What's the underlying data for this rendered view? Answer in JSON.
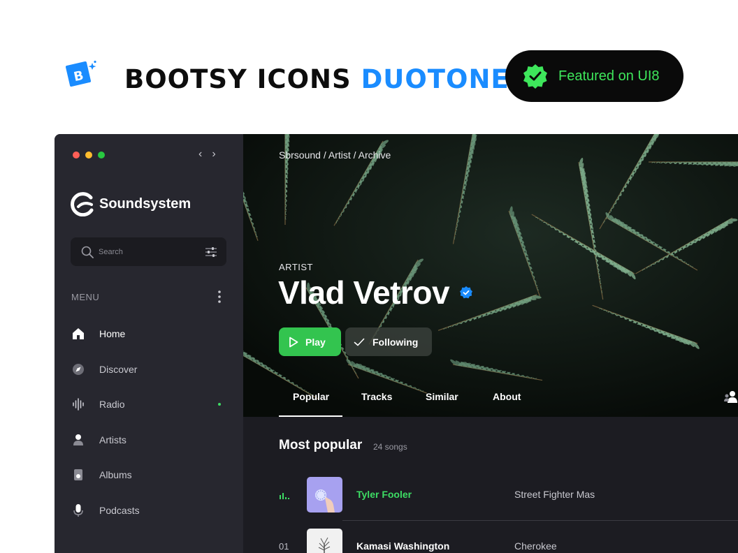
{
  "header": {
    "title_main": "BOOTSY ICONS",
    "title_accent": "DUOTONE",
    "featured_label": "Featured on UI8"
  },
  "app": {
    "name": "Soundsystem",
    "search": {
      "placeholder": "Search"
    },
    "menu_label": "MENU",
    "menu": [
      {
        "label": "Home",
        "icon": "home-icon"
      },
      {
        "label": "Discover",
        "icon": "compass-icon"
      },
      {
        "label": "Radio",
        "icon": "waveform-icon"
      },
      {
        "label": "Artists",
        "icon": "user-icon"
      },
      {
        "label": "Albums",
        "icon": "album-icon"
      },
      {
        "label": "Podcasts",
        "icon": "microphone-icon"
      }
    ],
    "colors": {
      "accent_green": "#33c44f",
      "accent_blue": "#1a8cff",
      "sidebar_bg": "#27272f",
      "main_bg": "#1c1c22"
    }
  },
  "main": {
    "breadcrumb": "Sbrsound / Artist / Archive",
    "artist_label": "ARTIST",
    "artist_name": "Vlad Vetrov",
    "play_label": "Play",
    "following_label": "Following",
    "tabs": [
      "Popular",
      "Tracks",
      "Similar",
      "About"
    ],
    "section_title": "Most popular",
    "section_count": "24 songs",
    "songs": [
      {
        "number": "",
        "title": "Tyler Fooler",
        "album": "Street Fighter Mas"
      },
      {
        "number": "01",
        "title": "Kamasi Washington",
        "album": "Cherokee"
      }
    ]
  }
}
